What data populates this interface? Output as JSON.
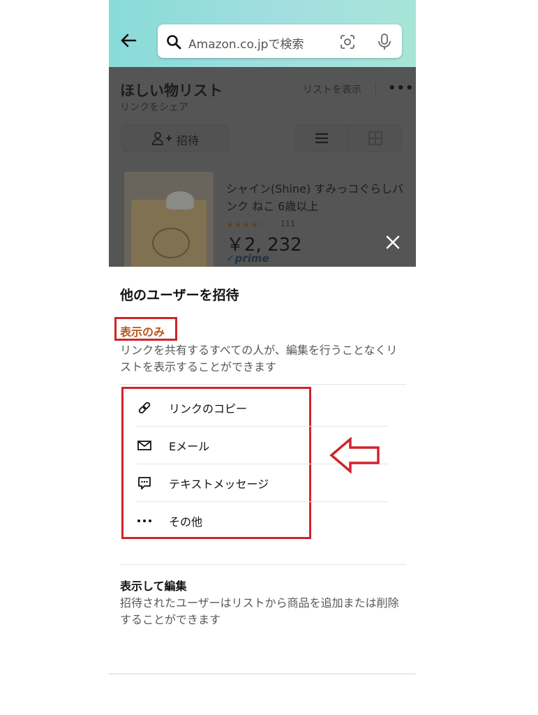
{
  "search": {
    "placeholder": "Amazon.co.jpで検索"
  },
  "wishlist": {
    "title": "ほしい物リスト",
    "share_link": "リンクをシェア",
    "view_list": "リストを表示",
    "more": "•••",
    "invite_label": "招待"
  },
  "product": {
    "title": "シャイン(Shine) すみっコぐらしバンク ねこ 6歳以上",
    "rating_stars": "★★★★☆",
    "rating_count": "111",
    "price": "￥2, 232",
    "badge": "prime"
  },
  "sheet": {
    "title": "他のユーザーを招待",
    "mode_view_only": {
      "label": "表示のみ",
      "description": "リンクを共有するすべての人が、編集を行うことなくリストを表示することができます"
    },
    "options": [
      {
        "label": "リンクのコピー",
        "icon": "link-icon"
      },
      {
        "label": "Eメール",
        "icon": "mail-icon"
      },
      {
        "label": "テキストメッセージ",
        "icon": "message-icon"
      },
      {
        "label": "その他",
        "icon": "more-dots-icon"
      }
    ],
    "mode_edit": {
      "label": "表示して編集",
      "description": "招待されたユーザーはリストから商品を追加または削除することができます"
    }
  },
  "colors": {
    "highlight_red": "#d2232a",
    "view_only_orange": "#b5561c",
    "header_teal": "#88dbd9",
    "overlay_dark": "#555555"
  }
}
